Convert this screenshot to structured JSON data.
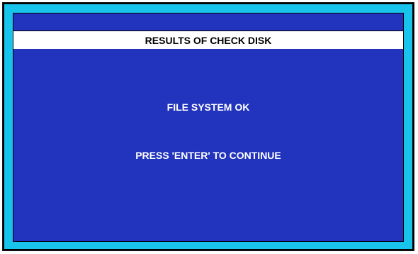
{
  "dialog": {
    "title": "RESULTS OF CHECK DISK",
    "status_message": "FILE SYSTEM OK",
    "prompt_message": "PRESS 'ENTER' TO CONTINUE"
  },
  "colors": {
    "frame_border": "#19c4ec",
    "background": "#2233bd",
    "title_bar": "#ffffff",
    "text": "#ffffff"
  }
}
